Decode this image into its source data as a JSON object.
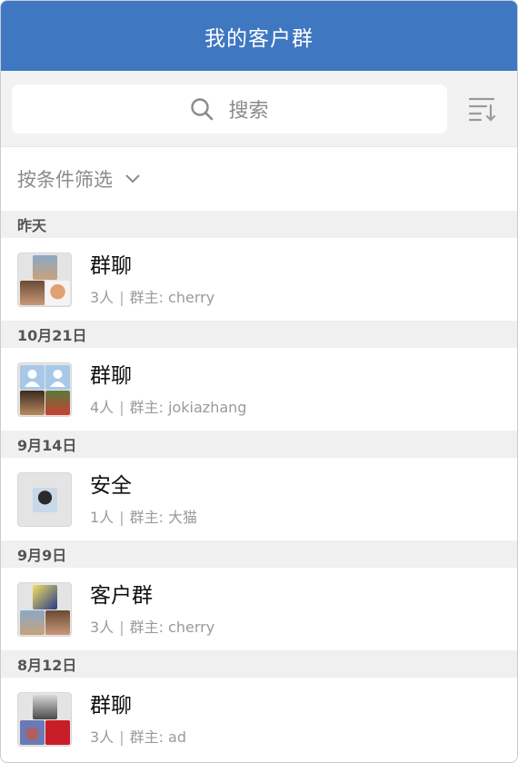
{
  "header": {
    "title": "我的客户群"
  },
  "search": {
    "placeholder": "搜索"
  },
  "filter": {
    "label": "按条件筛选"
  },
  "groups": [
    {
      "date": "昨天",
      "name": "群聊",
      "count": "3人",
      "owner_label": "群主: cherry"
    },
    {
      "date": "10月21日",
      "name": "群聊",
      "count": "4人",
      "owner_label": "群主: jokiazhang"
    },
    {
      "date": "9月14日",
      "name": "安全",
      "count": "1人",
      "owner_label": "群主: 大猫"
    },
    {
      "date": "9月9日",
      "name": "客户群",
      "count": "3人",
      "owner_label": "群主: cherry"
    },
    {
      "date": "8月12日",
      "name": "群聊",
      "count": "3人",
      "owner_label": "群主: ad"
    }
  ],
  "colors": {
    "header_bg": "#3f77c1",
    "section_bg": "#f0f0f0"
  },
  "icons": [
    "search-icon",
    "sort-icon",
    "chevron-down-icon"
  ]
}
